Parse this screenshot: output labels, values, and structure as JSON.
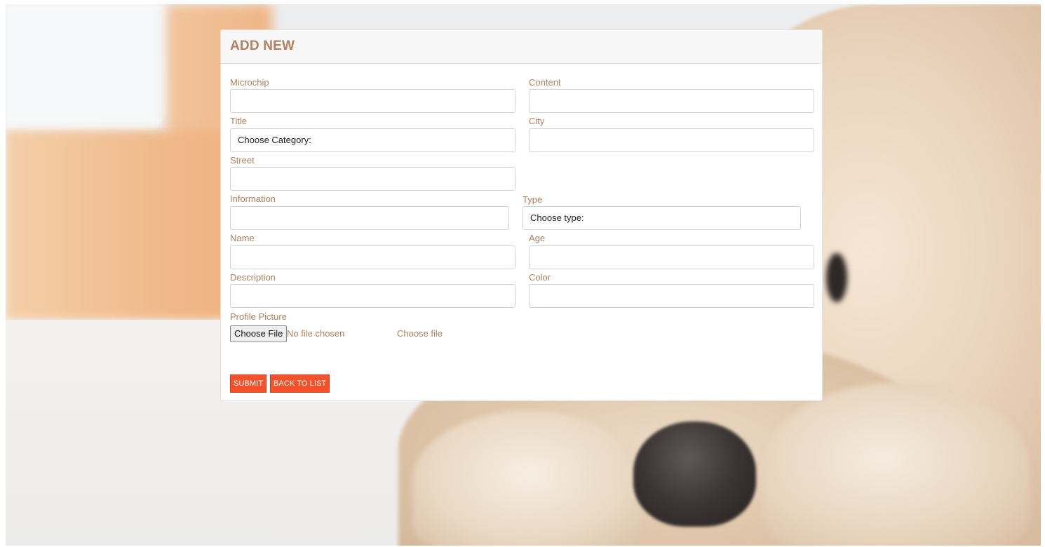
{
  "form": {
    "title": "ADD NEW",
    "fields": {
      "microchip": {
        "label": "Microchip",
        "value": ""
      },
      "content": {
        "label": "Content",
        "value": ""
      },
      "title": {
        "label": "Title",
        "selected": "Choose Category:"
      },
      "city": {
        "label": "City",
        "value": ""
      },
      "street": {
        "label": "Street",
        "value": ""
      },
      "information": {
        "label": "Information",
        "value": ""
      },
      "type": {
        "label": "Type",
        "selected": "Choose type:"
      },
      "name": {
        "label": "Name",
        "value": ""
      },
      "age": {
        "label": "Age",
        "value": ""
      },
      "description": {
        "label": "Description",
        "value": ""
      },
      "color": {
        "label": "Color",
        "value": ""
      }
    },
    "profile_picture": {
      "label": "Profile Picture",
      "button_label": "Choose File",
      "status": "No file chosen",
      "hint": "Choose file"
    },
    "buttons": {
      "submit": "SUBMIT",
      "back": "BACK TO LIST"
    }
  },
  "colors": {
    "accent_text": "#b3805f",
    "button_bg": "#f4522d"
  }
}
